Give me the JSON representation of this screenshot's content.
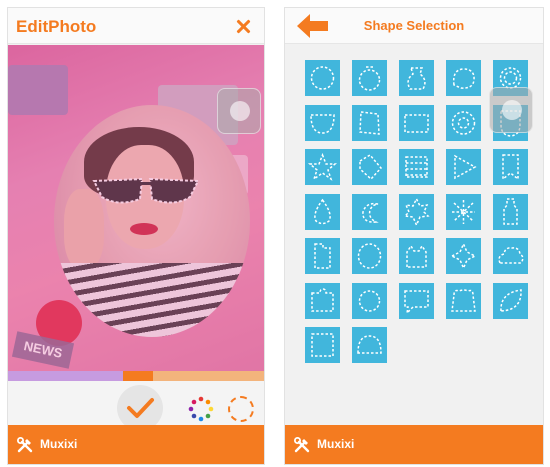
{
  "left_screen": {
    "title": "EditPhoto",
    "photo_label": "NEWS",
    "bottom_brand": "Muxixi",
    "toolbar": {
      "confirm_icon": "checkmark-icon",
      "palette_icon": "color-palette-icon",
      "shape_icon": "dashed-circle-icon"
    }
  },
  "right_screen": {
    "title": "Shape Selection",
    "bottom_brand": "Muxixi",
    "shapes": [
      "circle",
      "ornament",
      "vase",
      "bubble-cloud",
      "bubble-ring",
      "semicircle",
      "scroll",
      "rectangle",
      "flower",
      "shield",
      "star",
      "tag",
      "stitched-square",
      "triangle",
      "ribbon",
      "drop",
      "crescent",
      "maple-leaf",
      "snowflake",
      "bottle",
      "tall-rectangle",
      "oval",
      "cat",
      "sparkle",
      "cloud",
      "puzzle",
      "circle-small",
      "speech-bubble",
      "bear",
      "leaf",
      "square",
      "dome"
    ]
  },
  "colors": {
    "accent": "#f47b20",
    "tile": "#41b6dc",
    "palette_strip": [
      "#c69be0",
      "#f47b20",
      "#f3b47c"
    ]
  }
}
